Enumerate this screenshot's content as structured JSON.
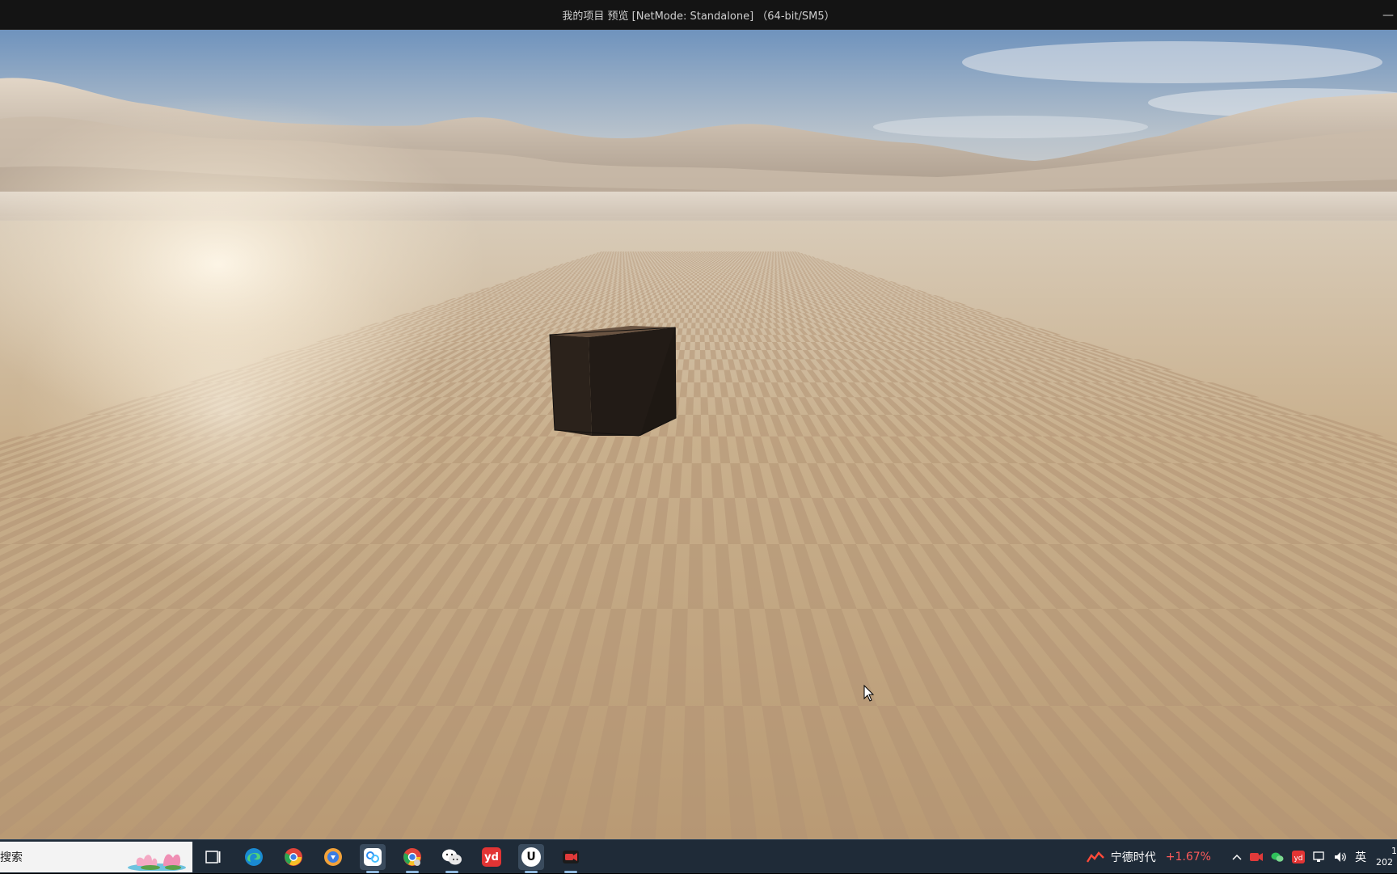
{
  "window": {
    "title": "我的项目 预览 [NetMode: Standalone] （64-bit/SM5）",
    "minimize_glyph": "—"
  },
  "viewport": {
    "description_icon": "cube-actor",
    "colors": {
      "sky_top": "#6f93bd",
      "sky_horizon": "#d9d4cb",
      "floor_light": "#d6c1a2",
      "floor_dark": "#a08565",
      "cube": "#2a221c"
    }
  },
  "taskbar": {
    "search_label": "搜索",
    "apps": [
      {
        "name": "task-view-icon"
      },
      {
        "name": "edge-icon"
      },
      {
        "name": "chrome-icon"
      },
      {
        "name": "browser-shield-icon"
      },
      {
        "name": "baidu-netdisk-icon"
      },
      {
        "name": "chrome-user-icon"
      },
      {
        "name": "wechat-icon"
      },
      {
        "name": "youdao-icon",
        "label": "yd"
      },
      {
        "name": "unreal-engine-icon",
        "label": "U"
      },
      {
        "name": "screen-recorder-icon"
      }
    ],
    "tray": {
      "stock_name": "宁德时代",
      "stock_change": "+1.67%",
      "ime": "英",
      "clock_line1": "1",
      "clock_line2": "202"
    }
  }
}
